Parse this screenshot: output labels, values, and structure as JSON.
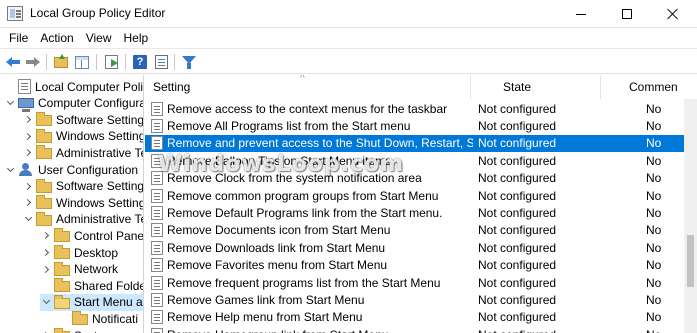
{
  "window": {
    "title": "Local Group Policy Editor",
    "controls": [
      "minimize",
      "maximize",
      "close"
    ]
  },
  "menu": [
    "File",
    "Action",
    "View",
    "Help"
  ],
  "toolbar": [
    "back-icon",
    "forward-icon",
    "up-folder-icon",
    "show-hide-tree-icon",
    "export-list-icon",
    "help-icon",
    "properties-icon",
    "filter-icon"
  ],
  "tree": [
    {
      "label": "Local Computer Policy",
      "icon": "policy-doc",
      "expander": "none",
      "indent": 0
    },
    {
      "label": "Computer Configura",
      "icon": "computer",
      "expander": "expanded",
      "indent": 0
    },
    {
      "label": "Software Settings",
      "icon": "folder",
      "expander": "collapsed",
      "indent": 1
    },
    {
      "label": "Windows Setting",
      "icon": "folder",
      "expander": "collapsed",
      "indent": 1
    },
    {
      "label": "Administrative Te",
      "icon": "folder",
      "expander": "collapsed",
      "indent": 1
    },
    {
      "label": "User Configuration",
      "icon": "user",
      "expander": "expanded",
      "indent": 0
    },
    {
      "label": "Software Settings",
      "icon": "folder",
      "expander": "collapsed",
      "indent": 1
    },
    {
      "label": "Windows Setting",
      "icon": "folder",
      "expander": "collapsed",
      "indent": 1
    },
    {
      "label": "Administrative Te",
      "icon": "folder",
      "expander": "expanded",
      "indent": 1
    },
    {
      "label": "Control Panel",
      "icon": "folder",
      "expander": "collapsed",
      "indent": 2
    },
    {
      "label": "Desktop",
      "icon": "folder",
      "expander": "collapsed",
      "indent": 2
    },
    {
      "label": "Network",
      "icon": "folder",
      "expander": "collapsed",
      "indent": 2
    },
    {
      "label": "Shared Folder",
      "icon": "folder",
      "expander": "none",
      "indent": 2
    },
    {
      "label": "Start Menu ar",
      "icon": "folder-open",
      "expander": "expanded",
      "indent": 2,
      "selected": true
    },
    {
      "label": "Notificati",
      "icon": "folder",
      "expander": "none",
      "indent": 3
    },
    {
      "label": "System",
      "icon": "folder",
      "expander": "collapsed",
      "indent": 2
    }
  ],
  "list": {
    "columns": {
      "setting": "Setting",
      "state": "State",
      "comment": "Commen"
    },
    "rows": [
      {
        "setting": "Remove access to the context menus for the taskbar",
        "state": "Not configured",
        "comment": "No"
      },
      {
        "setting": "Remove All Programs list from the Start menu",
        "state": "Not configured",
        "comment": "No"
      },
      {
        "setting": "Remove and prevent access to the Shut Down, Restart, Sleep...",
        "state": "Not configured",
        "comment": "No",
        "selected": true
      },
      {
        "setting": "Remove Balloon Tips on Start Menu items",
        "state": "Not configured",
        "comment": "No"
      },
      {
        "setting": "Remove Clock from the system notification area",
        "state": "Not configured",
        "comment": "No"
      },
      {
        "setting": "Remove common program groups from Start Menu",
        "state": "Not configured",
        "comment": "No"
      },
      {
        "setting": "Remove Default Programs link from the Start menu.",
        "state": "Not configured",
        "comment": "No"
      },
      {
        "setting": "Remove Documents icon from Start Menu",
        "state": "Not configured",
        "comment": "No"
      },
      {
        "setting": "Remove Downloads link from Start Menu",
        "state": "Not configured",
        "comment": "No"
      },
      {
        "setting": "Remove Favorites menu from Start Menu",
        "state": "Not configured",
        "comment": "No"
      },
      {
        "setting": "Remove frequent programs list from the Start Menu",
        "state": "Not configured",
        "comment": "No"
      },
      {
        "setting": "Remove Games link from Start Menu",
        "state": "Not configured",
        "comment": "No"
      },
      {
        "setting": "Remove Help menu from Start Menu",
        "state": "Not configured",
        "comment": "No"
      },
      {
        "setting": "Remove Homegroup link from Start Menu",
        "state": "Not configured",
        "comment": "No"
      }
    ]
  },
  "watermark": "WindowsLoop.com"
}
